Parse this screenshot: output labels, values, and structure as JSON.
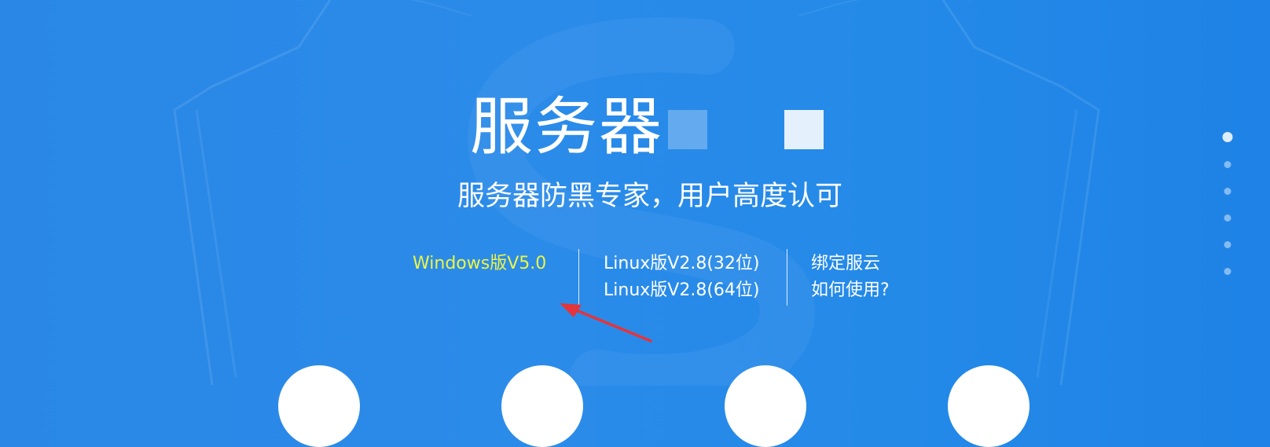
{
  "hero": {
    "title": "服务器",
    "subtitle": "服务器防黑专家，用户高度认可"
  },
  "downloads": {
    "windows": "Windows版V5.0",
    "linux_32": "Linux版V2.8(32位)",
    "linux_64": "Linux版V2.8(64位)",
    "bind": "绑定服云",
    "how_to_use": "如何使用?"
  },
  "carousel": {
    "slide_count": 6,
    "active_index": 0
  },
  "colors": {
    "background": "#2a87e6",
    "active_link": "#ecf545",
    "annotation_arrow": "#e5343a"
  }
}
